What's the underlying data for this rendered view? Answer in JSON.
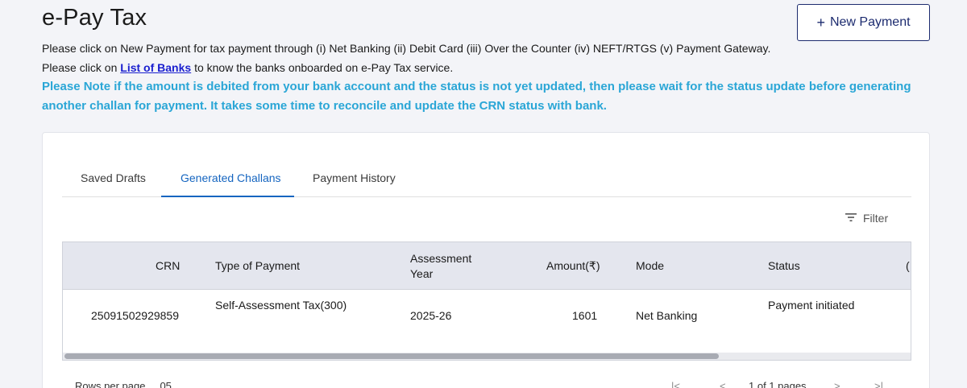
{
  "page": {
    "title": "e-Pay Tax",
    "new_payment_label": "New Payment",
    "info_line1": "Please click on New Payment for tax payment through (i) Net Banking (ii) Debit Card (iii) Over the Counter (iv) NEFT/RTGS (v) Payment Gateway.",
    "info_line2_prefix": "Please click on ",
    "info_line2_link": "List of Banks",
    "info_line2_suffix": " to know the banks onboarded on e-Pay Tax service.",
    "note": "Please Note if the amount is debited from your bank account and the status is not yet updated, then please wait for the status update before generating another challan for payment. It takes some time to reconcile and update the CRN status with bank."
  },
  "tabs": [
    {
      "label": "Saved Drafts"
    },
    {
      "label": "Generated Challans",
      "active": true
    },
    {
      "label": "Payment History"
    }
  ],
  "filter_label": "Filter",
  "table": {
    "headers": {
      "crn": "CRN",
      "type": "Type of Payment",
      "ay": "Assessment Year",
      "amount": "Amount(₹)",
      "mode": "Mode",
      "status": "Status"
    },
    "rows": [
      {
        "crn": "25091502929859",
        "type": "Self-Assessment Tax(300)",
        "ay": "2025-26",
        "amount": "1601",
        "mode": "Net Banking",
        "status": "Payment initiated"
      }
    ]
  },
  "footer": {
    "rows_per_page_label": "Rows per page",
    "rows_per_page_value": "05",
    "page_info": "1 of 1 pages"
  },
  "colors": {
    "accent": "#1565c0",
    "note": "#2aa6d6",
    "button_border": "#1c2b6f",
    "header_bg": "#e4e6ee"
  }
}
